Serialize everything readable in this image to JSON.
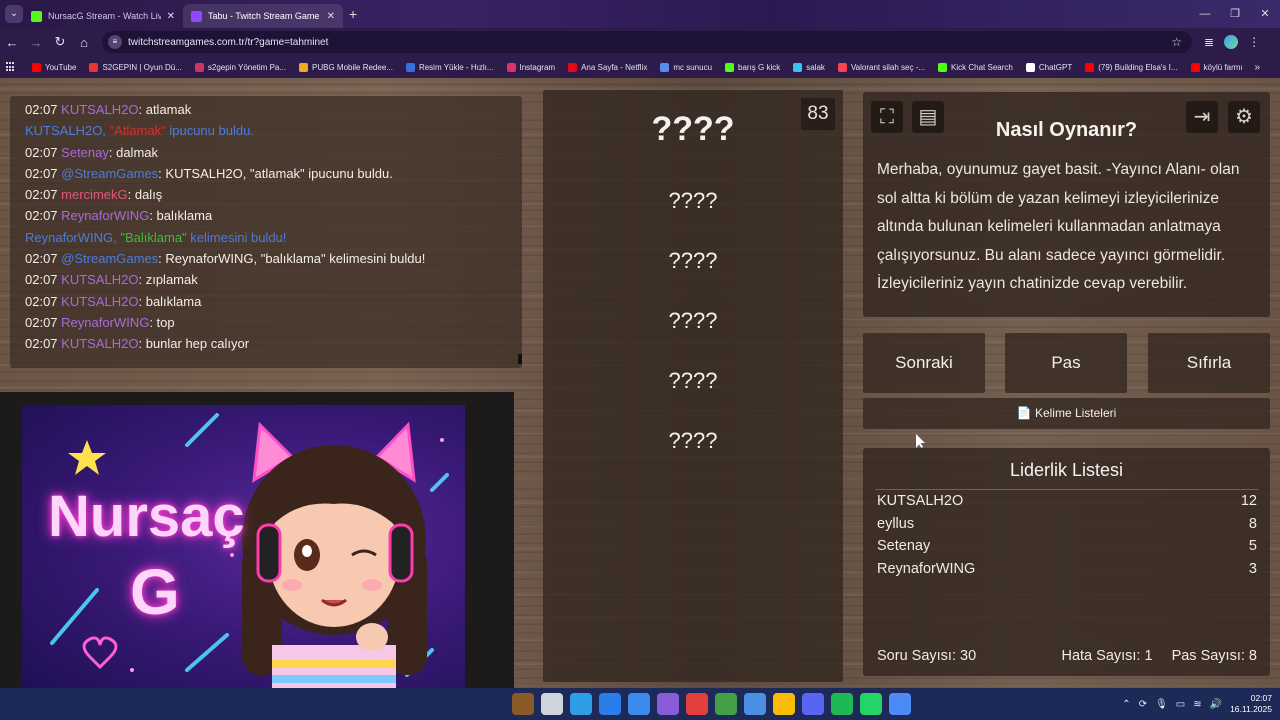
{
  "browser": {
    "tabs": [
      {
        "title": "NursacG Stream - Watch Live o",
        "active": false,
        "favicon_color": "#53fc18"
      },
      {
        "title": "Tabu - Twitch Stream Game",
        "active": true,
        "favicon_color": "#9146ff"
      }
    ],
    "url": "twitchstreamgames.com.tr/tr?game=tahminet",
    "bookmarks": [
      {
        "label": "YouTube",
        "color": "#ff0000"
      },
      {
        "label": "S2GEPIN | Oyun Dü...",
        "color": "#e33"
      },
      {
        "label": "s2gepin Yönetim Pa...",
        "color": "#c36"
      },
      {
        "label": "PUBG Mobile Redee...",
        "color": "#f5a623"
      },
      {
        "label": "Resim Yükle - Hızlı...",
        "color": "#3a6fd8"
      },
      {
        "label": "Instagram",
        "color": "#e1306c"
      },
      {
        "label": "Ana Sayfa - Netflix",
        "color": "#e50914"
      },
      {
        "label": "mc sunucu",
        "color": "#5b8def"
      },
      {
        "label": "barış G kick",
        "color": "#53fc18"
      },
      {
        "label": "salak",
        "color": "#36c5f0"
      },
      {
        "label": "Valorant silah seç -...",
        "color": "#fa4454"
      },
      {
        "label": "Kick Chat Search",
        "color": "#53fc18"
      },
      {
        "label": "ChatGPT",
        "color": "#ffffff"
      },
      {
        "label": "(79) Building Elsa's I...",
        "color": "#ff0000"
      },
      {
        "label": "köylü farmı",
        "color": "#ff0000"
      }
    ]
  },
  "chat": {
    "messages": [
      {
        "kind": "msg",
        "time": "02:07",
        "user": "KUTSALH2O",
        "user_color": "#a96bd8",
        "text": ": atlamak"
      },
      {
        "kind": "sys",
        "pre": "KUTSALH2O, ",
        "hl": "\"Atlamak\"",
        "hl_color": "#e02a2a",
        "post": " ipucunu buldu."
      },
      {
        "kind": "msg",
        "time": "02:07",
        "user": "Setenay",
        "user_color": "#a96bd8",
        "text": ": dalmak"
      },
      {
        "kind": "msg",
        "time": "02:07",
        "user": "@StreamGames",
        "user_color": "#4a7de0",
        "text": ": KUTSALH2O, \"atlamak\" ipucunu buldu."
      },
      {
        "kind": "msg",
        "time": "02:07",
        "user": "mercimekG",
        "user_color": "#e0567a",
        "text": ": dalış"
      },
      {
        "kind": "msg",
        "time": "02:07",
        "user": "ReynaforWING",
        "user_color": "#a96bd8",
        "text": ": balıklama"
      },
      {
        "kind": "sys",
        "pre": "ReynaforWING, ",
        "hl": "\"Balıklama\"",
        "hl_color": "#3cbb3c",
        "post": " kelimesini buldu!"
      },
      {
        "kind": "msg",
        "time": "02:07",
        "user": "@StreamGames",
        "user_color": "#4a7de0",
        "text": ": ReynaforWING, \"balıklama\" kelimesini buldu!"
      },
      {
        "kind": "msg",
        "time": "02:07",
        "user": "KUTSALH2O",
        "user_color": "#a96bd8",
        "text": ": zıplamak"
      },
      {
        "kind": "msg",
        "time": "02:07",
        "user": "KUTSALH2O",
        "user_color": "#a96bd8",
        "text": ": balıklama"
      },
      {
        "kind": "msg",
        "time": "02:07",
        "user": "ReynaforWING",
        "user_color": "#a96bd8",
        "text": ": top"
      },
      {
        "kind": "msg",
        "time": "02:07",
        "user": "KUTSALH2O",
        "user_color": "#a96bd8",
        "text": ": bunlar hep calıyor"
      }
    ]
  },
  "webcam": {
    "name_line1": "Nursaç",
    "name_line2": "G"
  },
  "words": {
    "counter": "83",
    "main": "????",
    "hints": [
      "????",
      "????",
      "????",
      "????",
      "????"
    ]
  },
  "howto": {
    "title": "Nasıl Oynanır?",
    "text": "Merhaba, oyunumuz gayet basit. -Yayıncı Alanı- olan sol altta ki bölüm de yazan kelimeyi izleyicilerinize altında bulunan kelimeleri kullanmadan anlatmaya çalışıyorsunuz. Bu alanı sadece yayıncı görmelidir. İzleyicileriniz yayın chatinizde cevap verebilir."
  },
  "controls": {
    "next": "Sonraki",
    "pass": "Pas",
    "reset": "Sıfırla",
    "word_lists": "📄 Kelime Listeleri"
  },
  "leaderboard": {
    "title": "Liderlik Listesi",
    "rows": [
      {
        "name": "KUTSALH2O",
        "score": "12"
      },
      {
        "name": "eyllus",
        "score": "8"
      },
      {
        "name": "Setenay",
        "score": "5"
      },
      {
        "name": "ReynaforWING",
        "score": "3"
      }
    ],
    "question_count": "Soru Sayısı: 30",
    "error_count": "Hata Sayısı: 1",
    "pass_count": "Pas Sayısı: 8"
  },
  "taskbar": {
    "time": "02:07",
    "date": "16.11.2025",
    "apps": [
      "#8a5a2b",
      "#d0d4dc",
      "#2e9de6",
      "#2b7de9",
      "#3c8cf0",
      "#8a5cd8",
      "#e43f3f",
      "#43a047",
      "#4a90e2",
      "#fbbc05",
      "#5865f2",
      "#1db954",
      "#25d366",
      "#4c8bf5"
    ]
  }
}
